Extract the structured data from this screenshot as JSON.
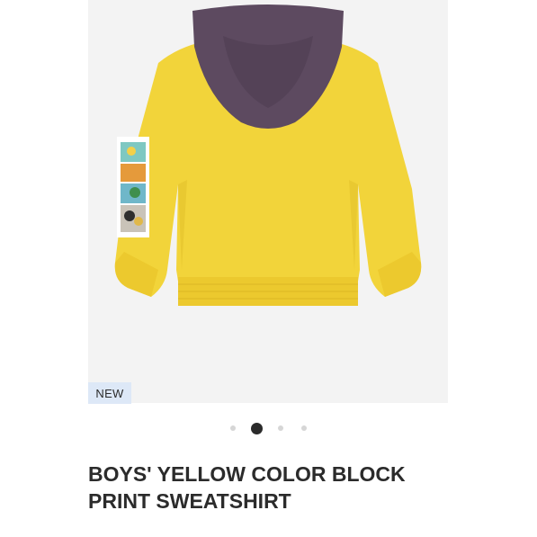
{
  "product": {
    "badge": "NEW",
    "title_line1": "BOYS' YELLOW COLOR BLOCK",
    "title_line2": "PRINT SWEATSHIRT"
  },
  "gallery": {
    "image_count": 4,
    "active_index": 1
  },
  "icons": {
    "wishlist": "heart-outline-icon"
  },
  "colors": {
    "sweatshirt": "#f2d43a",
    "hood": "#5d4a60",
    "badge_bg": "#dde8f7",
    "active_dot": "#2b2b2b",
    "inactive_dot": "#d6d6d6"
  }
}
